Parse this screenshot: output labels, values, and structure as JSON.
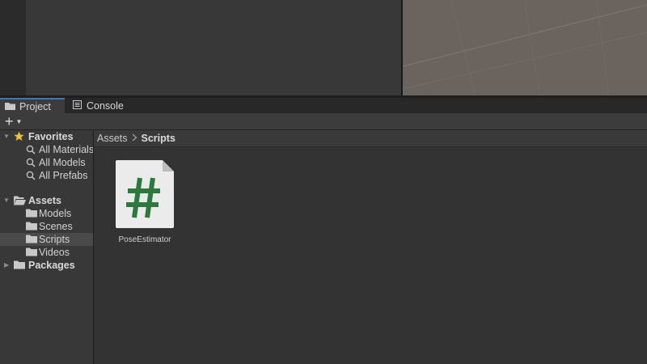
{
  "tabs": [
    {
      "label": "Project",
      "icon": "folder-icon",
      "active": true
    },
    {
      "label": "Console",
      "icon": "console-icon",
      "active": false
    }
  ],
  "toolbar": {
    "add_label": "+",
    "add_icon": "plus-icon"
  },
  "tree": {
    "favorites": {
      "label": "Favorites",
      "icon": "star-icon",
      "items": [
        "All Materials",
        "All Models",
        "All Prefabs"
      ]
    },
    "assets": {
      "label": "Assets",
      "icon": "open-folder-icon",
      "items": [
        "Models",
        "Scenes",
        "Scripts",
        "Videos"
      ],
      "selected": "Scripts"
    },
    "packages": {
      "label": "Packages",
      "icon": "folder-icon"
    }
  },
  "breadcrumb": {
    "root": "Assets",
    "current": "Scripts"
  },
  "assets_view": {
    "items": [
      {
        "name": "PoseEstimator",
        "icon": "csharp-script-icon"
      }
    ]
  },
  "colors": {
    "accent": "#3a79bb",
    "star": "#f3c231",
    "script_hash": "#2a7a3c",
    "scene_bg": "#6b635d"
  }
}
